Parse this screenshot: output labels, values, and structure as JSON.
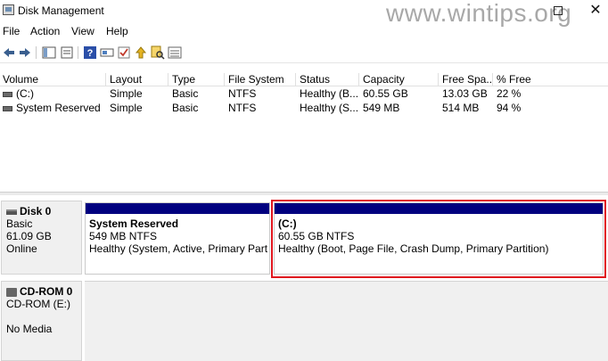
{
  "window": {
    "title": "Disk Management",
    "watermark": "www.wintips.org"
  },
  "menu": [
    "File",
    "Action",
    "View",
    "Help"
  ],
  "toolbar_icons": [
    "back-icon",
    "forward-icon",
    "console-tree-icon",
    "properties-icon",
    "help-icon",
    "connect-icon",
    "check-icon",
    "up-icon",
    "search-icon",
    "list-icon"
  ],
  "columns": [
    "Volume",
    "Layout",
    "Type",
    "File System",
    "Status",
    "Capacity",
    "Free Spa...",
    "% Free"
  ],
  "volumes": [
    {
      "volume": "(C:)",
      "layout": "Simple",
      "type": "Basic",
      "fs": "NTFS",
      "status": "Healthy (B...",
      "capacity": "60.55 GB",
      "free": "13.03 GB",
      "pct": "22 %"
    },
    {
      "volume": "System Reserved",
      "layout": "Simple",
      "type": "Basic",
      "fs": "NTFS",
      "status": "Healthy (S...",
      "capacity": "549 MB",
      "free": "514 MB",
      "pct": "94 %"
    }
  ],
  "disk0": {
    "name": "Disk 0",
    "kind": "Basic",
    "size": "61.09 GB",
    "state": "Online"
  },
  "partitions": [
    {
      "name": "System Reserved",
      "size": "549 MB NTFS",
      "status": "Healthy (System, Active, Primary Partitio"
    },
    {
      "name": "(C:)",
      "size": "60.55 GB NTFS",
      "status": "Healthy (Boot, Page File, Crash Dump, Primary Partition)"
    }
  ],
  "cdrom": {
    "name": "CD-ROM 0",
    "drive": "CD-ROM (E:)",
    "media": "No Media"
  },
  "colors": {
    "partition_bar": "#00007f",
    "highlight": "#e0161e"
  }
}
